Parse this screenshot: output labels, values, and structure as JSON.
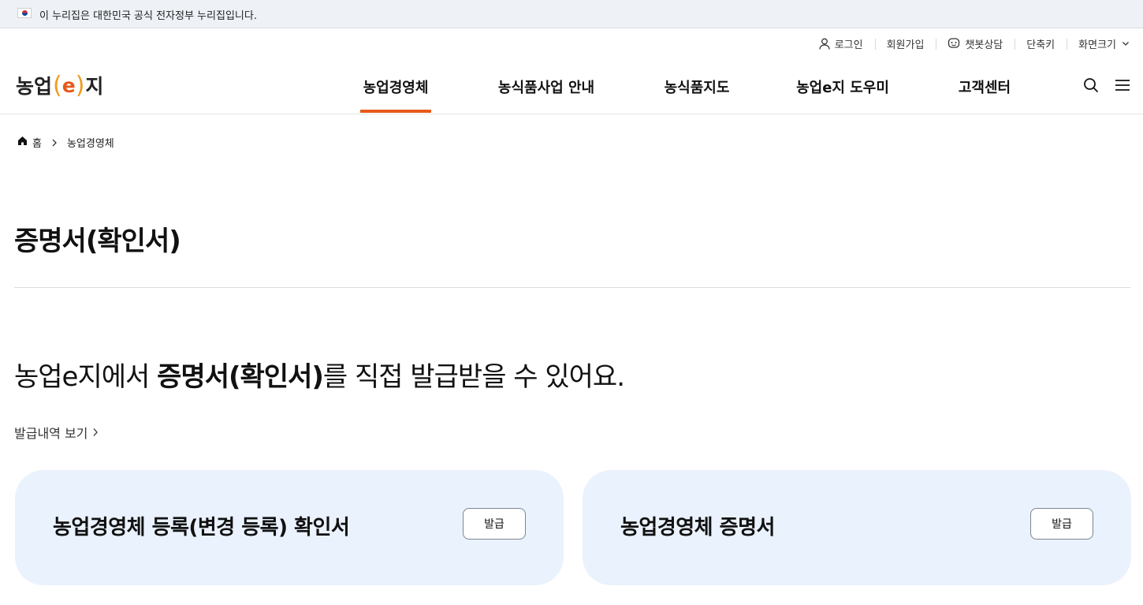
{
  "gov_banner": {
    "text": "이 누리집은 대한민국 공식 전자정부 누리집입니다."
  },
  "utility": {
    "login": "로그인",
    "signup": "회원가입",
    "chatbot": "챗봇상담",
    "shortcut": "단축키",
    "screen_size": "화면크기"
  },
  "logo": {
    "prefix": "농업",
    "letter": "e",
    "suffix": "지"
  },
  "gnb": {
    "items": [
      {
        "label": "농업경영체"
      },
      {
        "label": "농식품사업 안내"
      },
      {
        "label": "농식품지도"
      },
      {
        "label": "농업e지 도우미"
      },
      {
        "label": "고객센터"
      }
    ],
    "active_index": 0
  },
  "header_icons": {
    "search": "search-icon",
    "menu": "hamburger-menu-icon"
  },
  "breadcrumb": {
    "home": "홈",
    "current": "농업경영체"
  },
  "page_title": "증명서(확인서)",
  "lead": {
    "before": "농업e지에서 ",
    "emphasis": "증명서(확인서)",
    "after": "를 직접 발급받을 수 있어요."
  },
  "history_link": "발급내역 보기",
  "cards": [
    {
      "title": "농업경영체 등록(변경 등록) 확인서",
      "button": "발급"
    },
    {
      "title": "농업경영체 증명서",
      "button": "발급"
    }
  ],
  "colors": {
    "accent": "#e8591a",
    "card_bg": "#eaf2fd",
    "banner_bg": "#eef1f6"
  }
}
